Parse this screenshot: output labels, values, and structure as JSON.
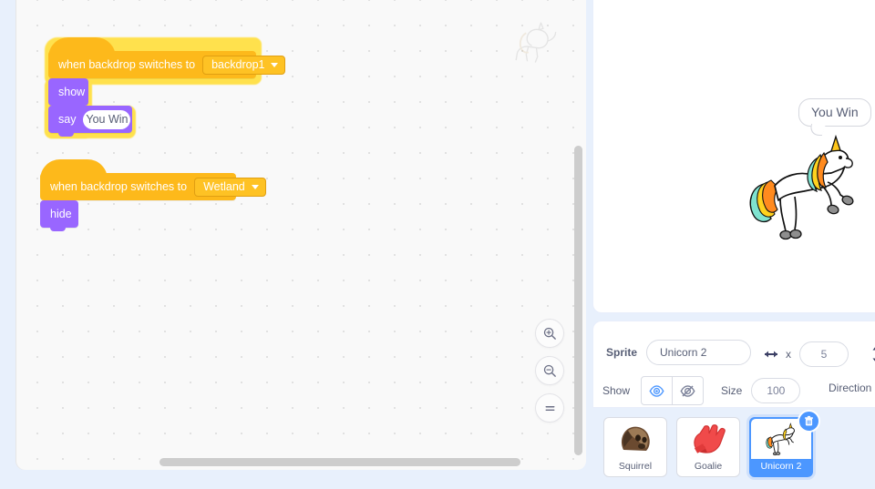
{
  "code_area": {
    "watermark_icon": "unicorn-watermark",
    "scripts": [
      {
        "hat_label": "when backdrop switches to",
        "dropdown_value": "backdrop1",
        "blocks": [
          {
            "label": "show"
          },
          {
            "label": "say",
            "input_value": "You Win"
          }
        ],
        "highlighted": true
      },
      {
        "hat_label": "when backdrop switches to",
        "dropdown_value": "Wetland",
        "blocks": [
          {
            "label": "hide"
          }
        ],
        "highlighted": false
      }
    ],
    "zoom_controls": [
      {
        "name": "zoom-in-button",
        "icon": "magnifier-plus-icon"
      },
      {
        "name": "zoom-out-button",
        "icon": "magnifier-minus-icon"
      },
      {
        "name": "zoom-reset-button",
        "icon": "equals-icon"
      }
    ]
  },
  "stage": {
    "speech_bubble_text": "You Win",
    "sprite_icon": "unicorn-sprite"
  },
  "sprite_info": {
    "sprite_label": "Sprite",
    "sprite_name": "Unicorn 2",
    "x_label": "x",
    "x_value": "5",
    "show_label": "Show",
    "show_visible_icon": "eye-icon",
    "show_hidden_icon": "eye-crossed-icon",
    "size_label": "Size",
    "size_value": "100",
    "direction_label": "Direction",
    "width_icon": "horizontal-arrow-icon",
    "height_icon": "vertical-arrow-icon",
    "accent_color": "#4c97ff"
  },
  "sprite_list": {
    "sprites": [
      {
        "name": "Squirrel",
        "icon": "squirrel-thumbnail",
        "selected": false
      },
      {
        "name": "Goalie",
        "icon": "goalie-glove-thumbnail",
        "selected": false
      },
      {
        "name": "Unicorn 2",
        "icon": "unicorn-thumbnail",
        "selected": true
      }
    ],
    "delete_badge_icon": "trash-icon"
  },
  "colors": {
    "events_block": "#fdb91b",
    "looks_block": "#9966ff",
    "highlight_glow": "#ffe14d",
    "panel_background": "#e8f0fc"
  }
}
